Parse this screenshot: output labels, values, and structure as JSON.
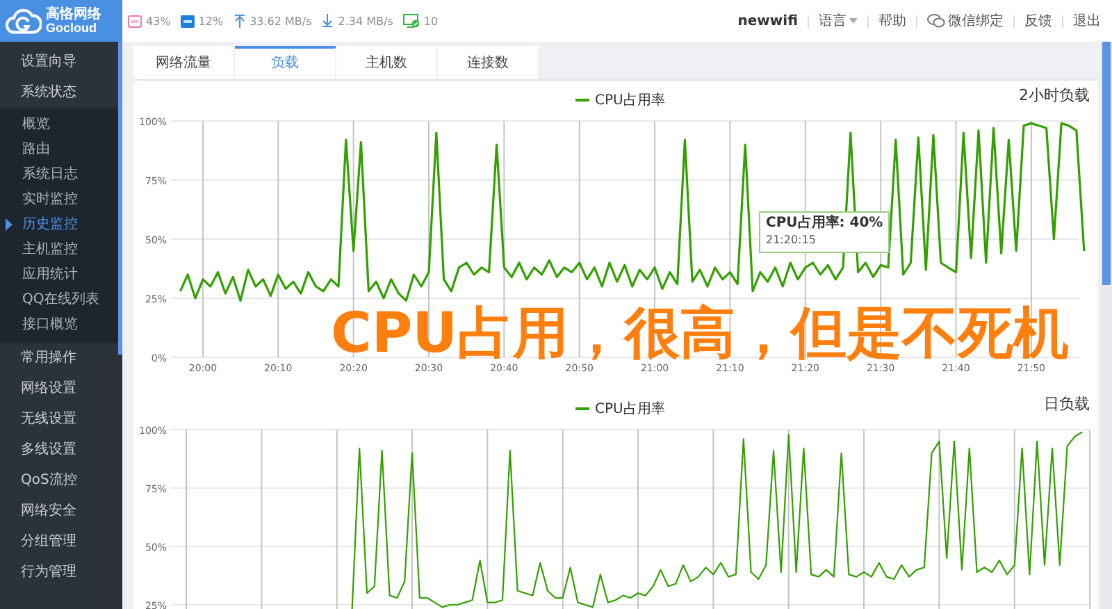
{
  "logo": {
    "name": "高恪网络",
    "brand": "Gocloud"
  },
  "status": {
    "cpu": "43%",
    "ram": "12%",
    "upload": "33.62 MB/s",
    "download": "2.34 MB/s",
    "hosts": "10"
  },
  "top_nav": {
    "user": "newwifi",
    "items": [
      {
        "label": "语言",
        "kind": "dropdown"
      },
      {
        "label": "帮助",
        "kind": "link"
      },
      {
        "label": "微信绑定",
        "kind": "wechat"
      },
      {
        "label": "反馈",
        "kind": "link"
      },
      {
        "label": "退出",
        "kind": "link"
      }
    ]
  },
  "sidebar": {
    "items": [
      {
        "label": "设置向导"
      },
      {
        "label": "系统状态",
        "expanded": true,
        "children": [
          {
            "label": "概览",
            "selected": false
          },
          {
            "label": "路由",
            "selected": false
          },
          {
            "label": "系统日志",
            "selected": false
          },
          {
            "label": "实时监控",
            "selected": false
          },
          {
            "label": "历史监控",
            "selected": true
          },
          {
            "label": "主机监控",
            "selected": false
          },
          {
            "label": "应用统计",
            "selected": false
          },
          {
            "label": "QQ在线列表",
            "selected": false
          },
          {
            "label": "接口概览",
            "selected": false
          }
        ]
      },
      {
        "label": "常用操作"
      },
      {
        "label": "网络设置"
      },
      {
        "label": "无线设置"
      },
      {
        "label": "多线设置"
      },
      {
        "label": "QoS流控"
      },
      {
        "label": "网络安全"
      },
      {
        "label": "分组管理"
      },
      {
        "label": "行为管理"
      }
    ]
  },
  "tabs": [
    {
      "label": "网络流量",
      "selected": false
    },
    {
      "label": "负载",
      "selected": true
    },
    {
      "label": "主机数",
      "selected": false
    },
    {
      "label": "连接数",
      "selected": false
    }
  ],
  "charts": [
    {
      "heading": "2小时负载",
      "tooltip": {
        "title": "CPU占用率: 40%",
        "time": "21:20:15"
      },
      "chart_data": {
        "type": "line",
        "grid": true,
        "ylim": [
          0,
          100
        ],
        "categories": [
          null,
          null,
          null,
          "20:00",
          null,
          null,
          null,
          null,
          null,
          null,
          null,
          null,
          null,
          "20:10",
          null,
          null,
          null,
          null,
          null,
          null,
          null,
          null,
          null,
          "20:20",
          null,
          null,
          null,
          null,
          null,
          null,
          null,
          null,
          null,
          "20:30",
          null,
          null,
          null,
          null,
          null,
          null,
          null,
          null,
          null,
          "20:40",
          null,
          null,
          null,
          null,
          null,
          null,
          null,
          null,
          null,
          "20:50",
          null,
          null,
          null,
          null,
          null,
          null,
          null,
          null,
          null,
          "21:00",
          null,
          null,
          null,
          null,
          null,
          null,
          null,
          null,
          null,
          "21:10",
          null,
          null,
          null,
          null,
          null,
          null,
          null,
          null,
          null,
          "21:20",
          null,
          null,
          null,
          null,
          null,
          null,
          null,
          null,
          null,
          "21:30",
          null,
          null,
          null,
          null,
          null,
          null,
          null,
          null,
          null,
          "21:40",
          null,
          null,
          null,
          null,
          null,
          null,
          null,
          null,
          null,
          "21:50",
          null,
          null,
          null,
          null,
          null,
          null,
          null
        ],
        "yticks": [
          {
            "value": 0,
            "label": "0%"
          },
          {
            "value": 25,
            "label": "25%"
          },
          {
            "value": 50,
            "label": "50%"
          },
          {
            "value": 75,
            "label": "75%"
          },
          {
            "value": 100,
            "label": "100%"
          }
        ],
        "series": [
          {
            "name": "CPU占用率",
            "color": "#33a000",
            "values": [
              28,
              35,
              25,
              33,
              30,
              36,
              27,
              34,
              24,
              37,
              30,
              33,
              26,
              35,
              29,
              32,
              27,
              36,
              30,
              28,
              33,
              30,
              92,
              45,
              91,
              28,
              32,
              25,
              33,
              27,
              24,
              35,
              30,
              36,
              95,
              33,
              28,
              38,
              40,
              35,
              38,
              36,
              90,
              38,
              34,
              40,
              33,
              38,
              35,
              41,
              34,
              38,
              36,
              40,
              33,
              38,
              30,
              40,
              32,
              39,
              30,
              37,
              33,
              38,
              29,
              36,
              31,
              92,
              32,
              37,
              30,
              38,
              33,
              36,
              31,
              90,
              28,
              36,
              32,
              38,
              30,
              40,
              33,
              38,
              40,
              35,
              39,
              33,
              38,
              95,
              36,
              40,
              34,
              39,
              38,
              92,
              35,
              40,
              93,
              37,
              94,
              40,
              38,
              36,
              95,
              42,
              96,
              40,
              97,
              44,
              92,
              45,
              98,
              99,
              98,
              97,
              50,
              99,
              98,
              96,
              45
            ]
          }
        ]
      }
    },
    {
      "heading": "日负载",
      "chart_data": {
        "type": "line",
        "grid": true,
        "ylim": [
          0,
          100
        ],
        "categories": [
          null,
          null,
          null,
          null,
          null,
          null,
          null,
          null,
          null,
          null,
          null,
          null,
          null,
          null,
          null,
          null,
          null,
          null,
          null,
          null,
          null,
          null,
          null,
          null,
          null,
          null,
          null,
          null,
          null,
          null,
          null,
          null,
          null,
          null,
          null,
          null,
          null,
          null,
          null,
          null,
          null,
          null,
          null,
          null,
          null,
          null,
          null,
          null,
          null,
          null,
          null,
          null,
          null,
          null,
          null,
          null,
          null,
          null,
          null,
          null,
          null,
          null,
          null,
          null,
          null,
          null,
          null,
          null,
          null,
          null,
          null,
          null,
          null,
          null,
          null,
          null,
          null,
          null,
          null,
          null,
          null,
          null,
          null,
          null,
          null,
          null,
          null,
          null,
          null,
          null,
          null,
          null,
          null,
          null,
          null,
          null,
          null,
          null,
          null,
          null,
          null,
          null,
          null,
          null,
          null,
          null,
          null,
          null,
          null,
          null,
          null,
          null,
          null,
          null,
          null,
          null,
          null,
          null,
          null,
          null
        ],
        "yticks": [
          {
            "value": 25,
            "label": "25%"
          },
          {
            "value": 50,
            "label": "50%"
          },
          {
            "value": 75,
            "label": "75%"
          },
          {
            "value": 100,
            "label": "100%"
          }
        ],
        "series": [
          {
            "name": "CPU占用率",
            "color": "#33a000",
            "values": [
              null,
              null,
              null,
              null,
              null,
              null,
              null,
              null,
              null,
              null,
              null,
              null,
              null,
              null,
              null,
              null,
              null,
              null,
              null,
              null,
              null,
              null,
              22,
              92,
              30,
              33,
              91,
              29,
              28,
              35,
              90,
              28,
              28,
              26,
              24,
              25,
              25,
              26,
              27,
              44,
              26,
              26,
              27,
              91,
              31,
              30,
              29,
              43,
              31,
              28,
              28,
              41,
              26,
              25,
              24,
              38,
              26,
              27,
              29,
              28,
              30,
              29,
              33,
              40,
              33,
              34,
              42,
              35,
              37,
              41,
              38,
              43,
              37,
              38,
              96,
              39,
              36,
              42,
              91,
              39,
              98,
              39,
              92,
              38,
              37,
              40,
              37,
              90,
              38,
              37,
              39,
              37,
              43,
              37,
              36,
              42,
              37,
              40,
              41,
              90,
              95,
              45,
              95,
              40,
              92,
              39,
              41,
              39,
              44,
              38,
              42,
              92,
              38,
              95,
              42,
              92,
              42,
              93,
              97,
              99
            ]
          }
        ]
      }
    }
  ],
  "overlay_caption": "CPU占用，很高，但是不死机"
}
